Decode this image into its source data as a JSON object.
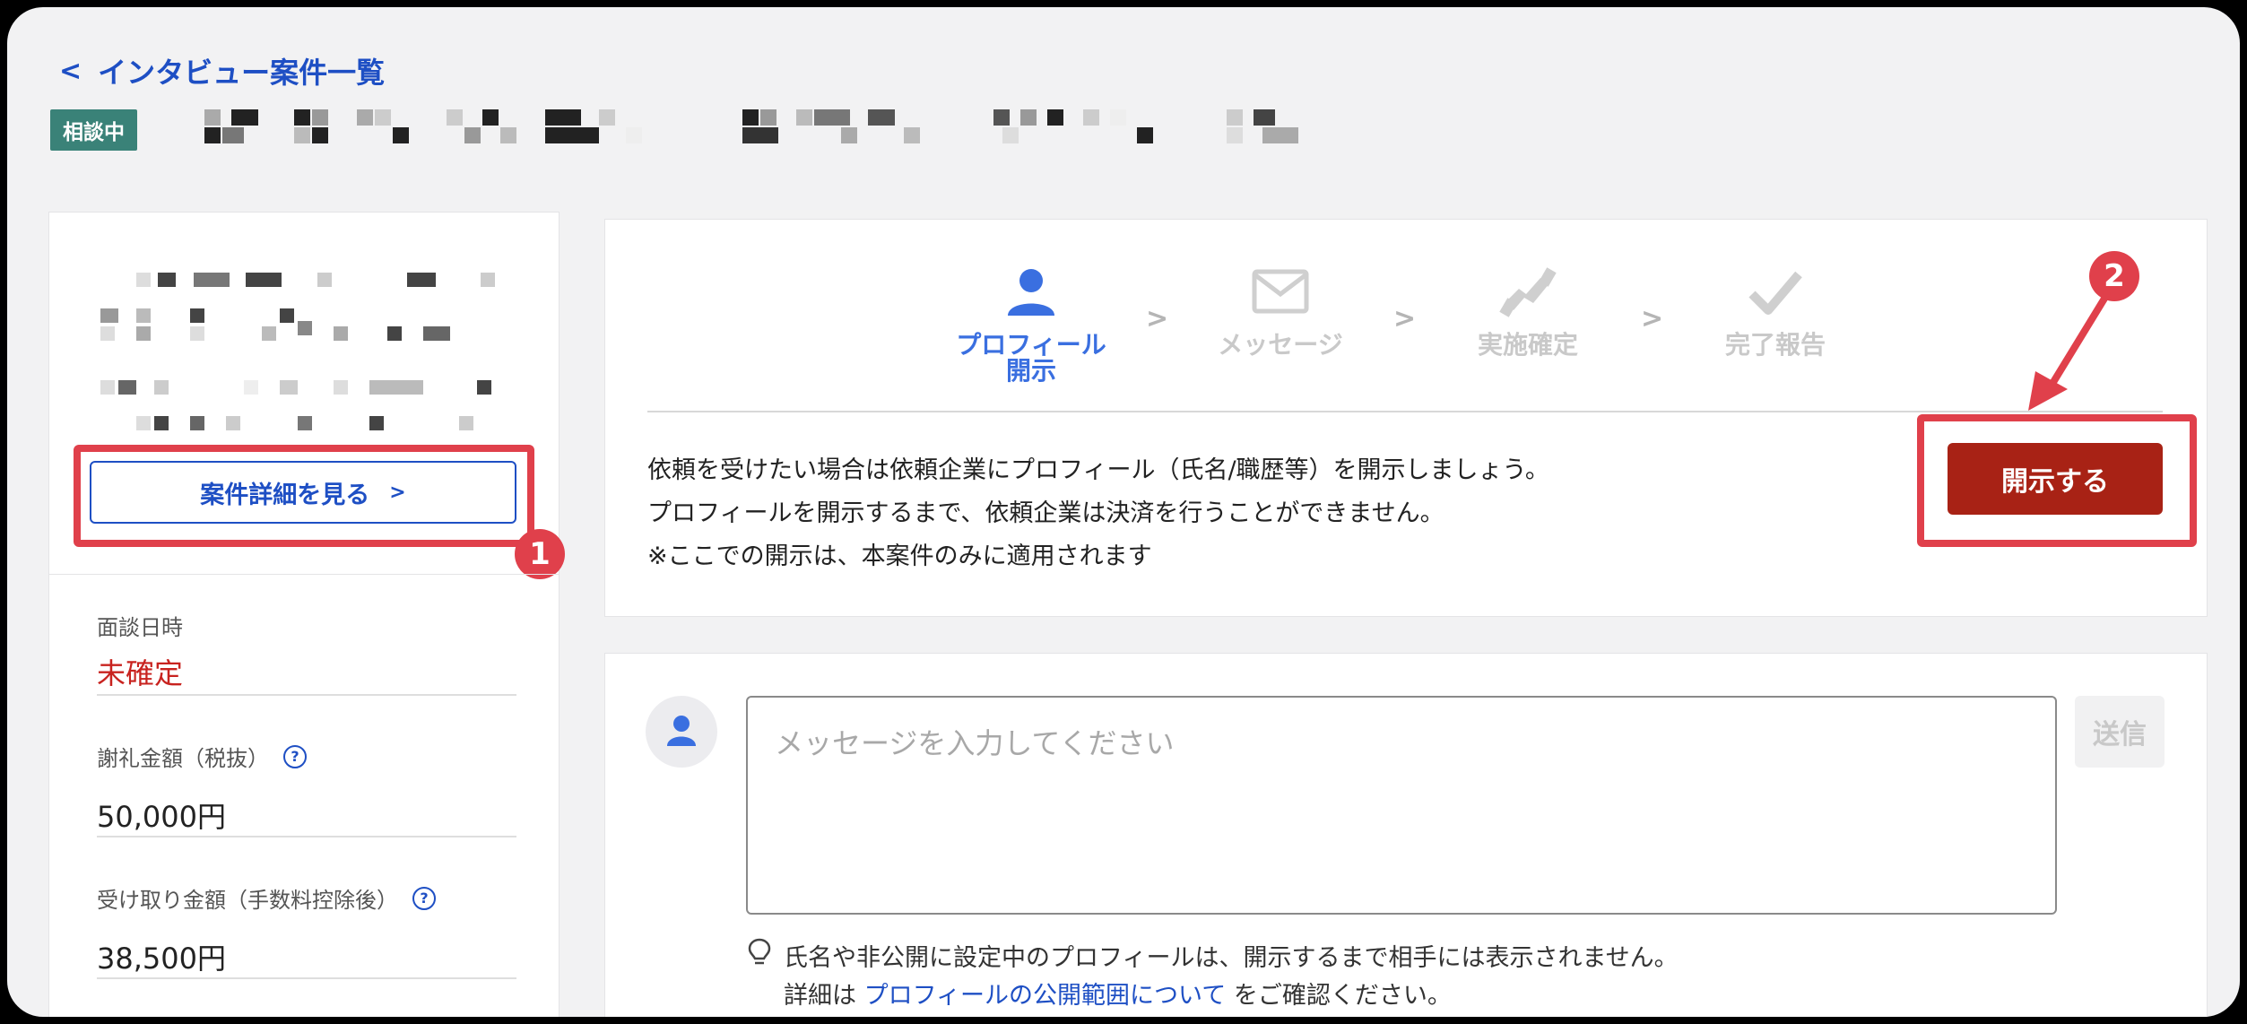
{
  "header": {
    "back_label": "インタビュー案件一覧",
    "status_badge": "相談中"
  },
  "left_panel": {
    "detail_button": "案件詳細を見る",
    "fields": [
      {
        "label": "面談日時",
        "value": "未確定",
        "value_color": "#c8231f",
        "help": false
      },
      {
        "label": "謝礼金額（税抜）",
        "value": "50,000円",
        "help": true
      },
      {
        "label": "受け取り金額（手数料控除後）",
        "value": "38,500円",
        "help": true
      }
    ]
  },
  "steps": [
    {
      "label_line1": "プロフィール",
      "label_line2": "開示",
      "icon": "person-icon",
      "active": true
    },
    {
      "label_line1": "メッセージ",
      "label_line2": "",
      "icon": "envelope-icon",
      "active": false
    },
    {
      "label_line1": "実施確定",
      "label_line2": "",
      "icon": "handshake-icon",
      "active": false
    },
    {
      "label_line1": "完了報告",
      "label_line2": "",
      "icon": "check-icon",
      "active": false
    }
  ],
  "disclosure": {
    "lines": [
      "依頼を受けたい場合は依頼企業にプロフィール（氏名/職歴等）を開示しましょう。",
      "プロフィールを開示するまで、依頼企業は決済を行うことができません。",
      "※ここでの開示は、本案件のみに適用されます"
    ],
    "open_button": "開示する"
  },
  "message": {
    "placeholder": "メッセージを入力してください",
    "send_button": "送信",
    "note_line1": "氏名や非公開に設定中のプロフィールは、開示するまで相手には表示されません。",
    "note_prefix": "詳細は ",
    "note_link": "プロフィールの公開範囲について",
    "note_suffix": " をご確認ください。"
  },
  "annotations": {
    "marker_1": "1",
    "marker_2": "2"
  },
  "colors": {
    "accent_blue": "#1e4fc4",
    "step_active": "#3a6fe0",
    "open_button": "#a82215",
    "highlight_red": "#e0404b",
    "badge_green": "#3a8278"
  }
}
